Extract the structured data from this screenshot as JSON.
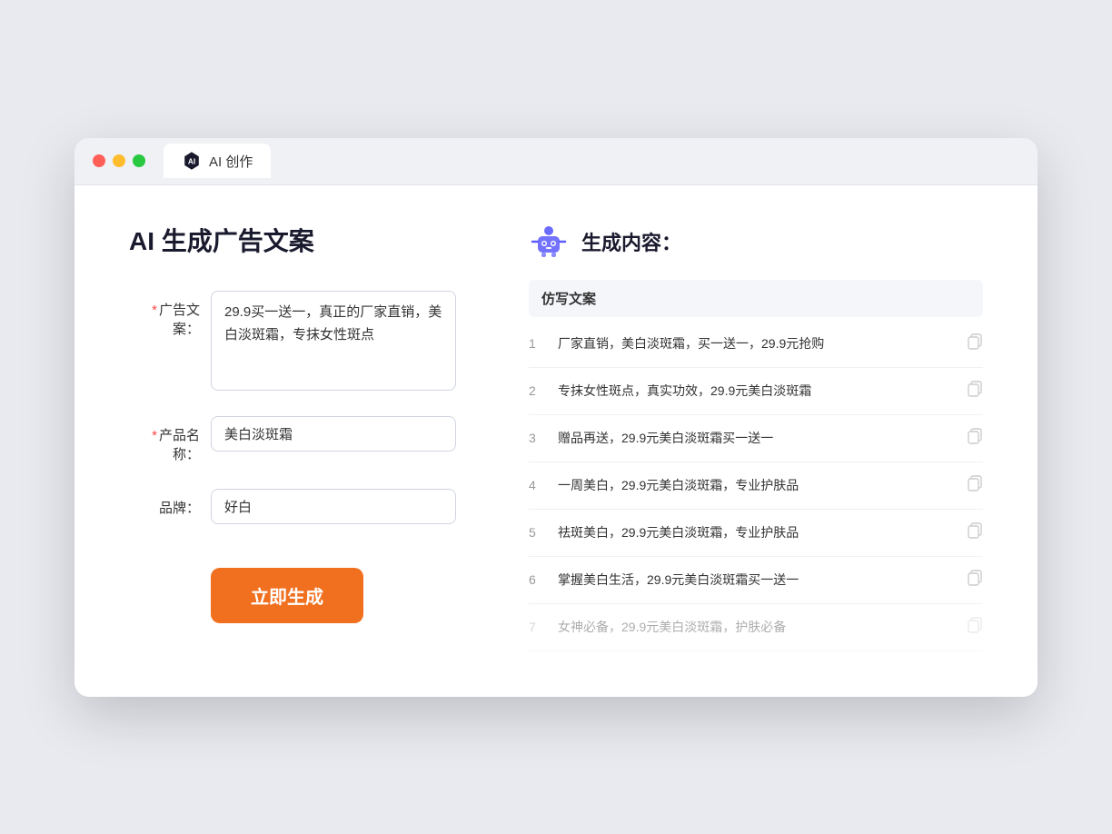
{
  "browser": {
    "tab_label": "AI 创作"
  },
  "page": {
    "title": "AI 生成广告文案",
    "form": {
      "ad_copy_label": "广告文案：",
      "ad_copy_required": "*",
      "ad_copy_value": "29.9买一送一，真正的厂家直销，美白淡斑霜，专抹女性斑点",
      "product_name_label": "产品名称：",
      "product_name_required": "*",
      "product_name_value": "美白淡斑霜",
      "brand_label": "品牌：",
      "brand_value": "好白",
      "generate_btn_label": "立即生成"
    },
    "result": {
      "header_label": "生成内容：",
      "table_column": "仿写文案",
      "rows": [
        {
          "num": "1",
          "text": "厂家直销，美白淡斑霜，买一送一，29.9元抢购",
          "dimmed": false
        },
        {
          "num": "2",
          "text": "专抹女性斑点，真实功效，29.9元美白淡斑霜",
          "dimmed": false
        },
        {
          "num": "3",
          "text": "赠品再送，29.9元美白淡斑霜买一送一",
          "dimmed": false
        },
        {
          "num": "4",
          "text": "一周美白，29.9元美白淡斑霜，专业护肤品",
          "dimmed": false
        },
        {
          "num": "5",
          "text": "祛斑美白，29.9元美白淡斑霜，专业护肤品",
          "dimmed": false
        },
        {
          "num": "6",
          "text": "掌握美白生活，29.9元美白淡斑霜买一送一",
          "dimmed": false
        },
        {
          "num": "7",
          "text": "女神必备，29.9元美白淡斑霜，护肤必备",
          "dimmed": true
        }
      ]
    }
  }
}
